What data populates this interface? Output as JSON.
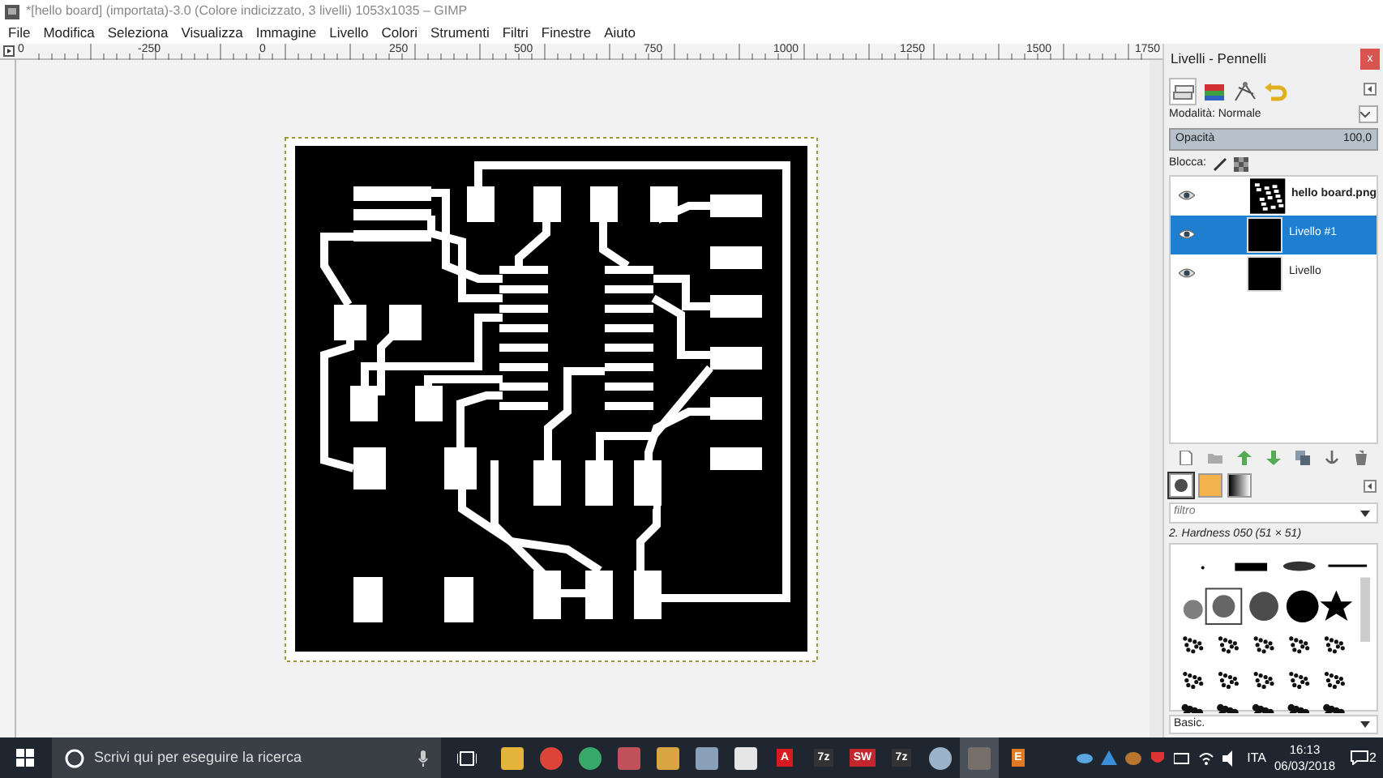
{
  "window": {
    "title": "*[hello board] (importata)-3.0 (Colore indicizzato, 3 livelli) 1053x1035 – GIMP"
  },
  "menu": [
    "File",
    "Modifica",
    "Seleziona",
    "Visualizza",
    "Immagine",
    "Livello",
    "Colori",
    "Strumenti",
    "Filtri",
    "Finestre",
    "Aiuto"
  ],
  "ruler": {
    "labels": [
      "0",
      "-250",
      "0",
      "250",
      "500",
      "750",
      "1000",
      "1250",
      "1500",
      "1750"
    ]
  },
  "dock": {
    "title": "Livelli - Pennelli",
    "close": "x",
    "tabs": [
      {
        "kind": "layers",
        "selected": true
      },
      {
        "kind": "channels",
        "selected": false
      },
      {
        "kind": "paths",
        "selected": false
      },
      {
        "kind": "undo",
        "selected": false
      }
    ],
    "mode_label": "Modalità: Normale",
    "opacity_label": "Opacità",
    "opacity_value": "100,0",
    "level": 1.0,
    "lock_label": "Blocca:",
    "layers": [
      {
        "name": "hello board.png",
        "visible": true,
        "selected": false,
        "kind": "pcb"
      },
      {
        "name": "Livello #1",
        "visible": true,
        "selected": true,
        "kind": "black"
      },
      {
        "name": "Livello",
        "visible": true,
        "selected": false,
        "kind": "black"
      }
    ],
    "brush_tabs": [
      {
        "kind": "brush",
        "selected": true
      },
      {
        "kind": "pattern",
        "selected": false
      },
      {
        "kind": "gradient",
        "selected": false
      }
    ],
    "filter_placeholder": "filtro",
    "brush_name": "2. Hardness 050 (51 × 51)",
    "preset": "Basic."
  },
  "taskbar": {
    "search": "Scrivi qui per eseguire la ricerca",
    "apps": [
      {
        "kind": "tile",
        "color": "#e3b33c",
        "selected": false
      },
      {
        "kind": "round",
        "color": "#db4437",
        "selected": false
      },
      {
        "kind": "round",
        "color": "#39a96b",
        "selected": false
      },
      {
        "kind": "tile",
        "color": "#c0505a",
        "selected": false
      },
      {
        "kind": "tile",
        "color": "#d9a441",
        "selected": false
      },
      {
        "kind": "tile",
        "color": "#8aa0b8",
        "selected": false
      },
      {
        "kind": "tile",
        "color": "#e6e6e6",
        "selected": false
      },
      {
        "kind": "text",
        "label": "A",
        "color": "#d71920",
        "selected": false
      },
      {
        "kind": "text",
        "label": "7z",
        "color": "#333333",
        "selected": false
      },
      {
        "kind": "text",
        "label": "SW",
        "color": "#c4262e",
        "selected": false
      },
      {
        "kind": "text",
        "label": "7z",
        "color": "#333333",
        "selected": false
      },
      {
        "kind": "round",
        "color": "#9bb3c8",
        "selected": false
      },
      {
        "kind": "tile",
        "color": "#77706a",
        "selected": true
      },
      {
        "kind": "text",
        "label": "E",
        "color": "#e07b24",
        "selected": false
      }
    ],
    "language": "ITA",
    "time": "16:13",
    "date": "06/03/2018",
    "notifications": "2"
  }
}
